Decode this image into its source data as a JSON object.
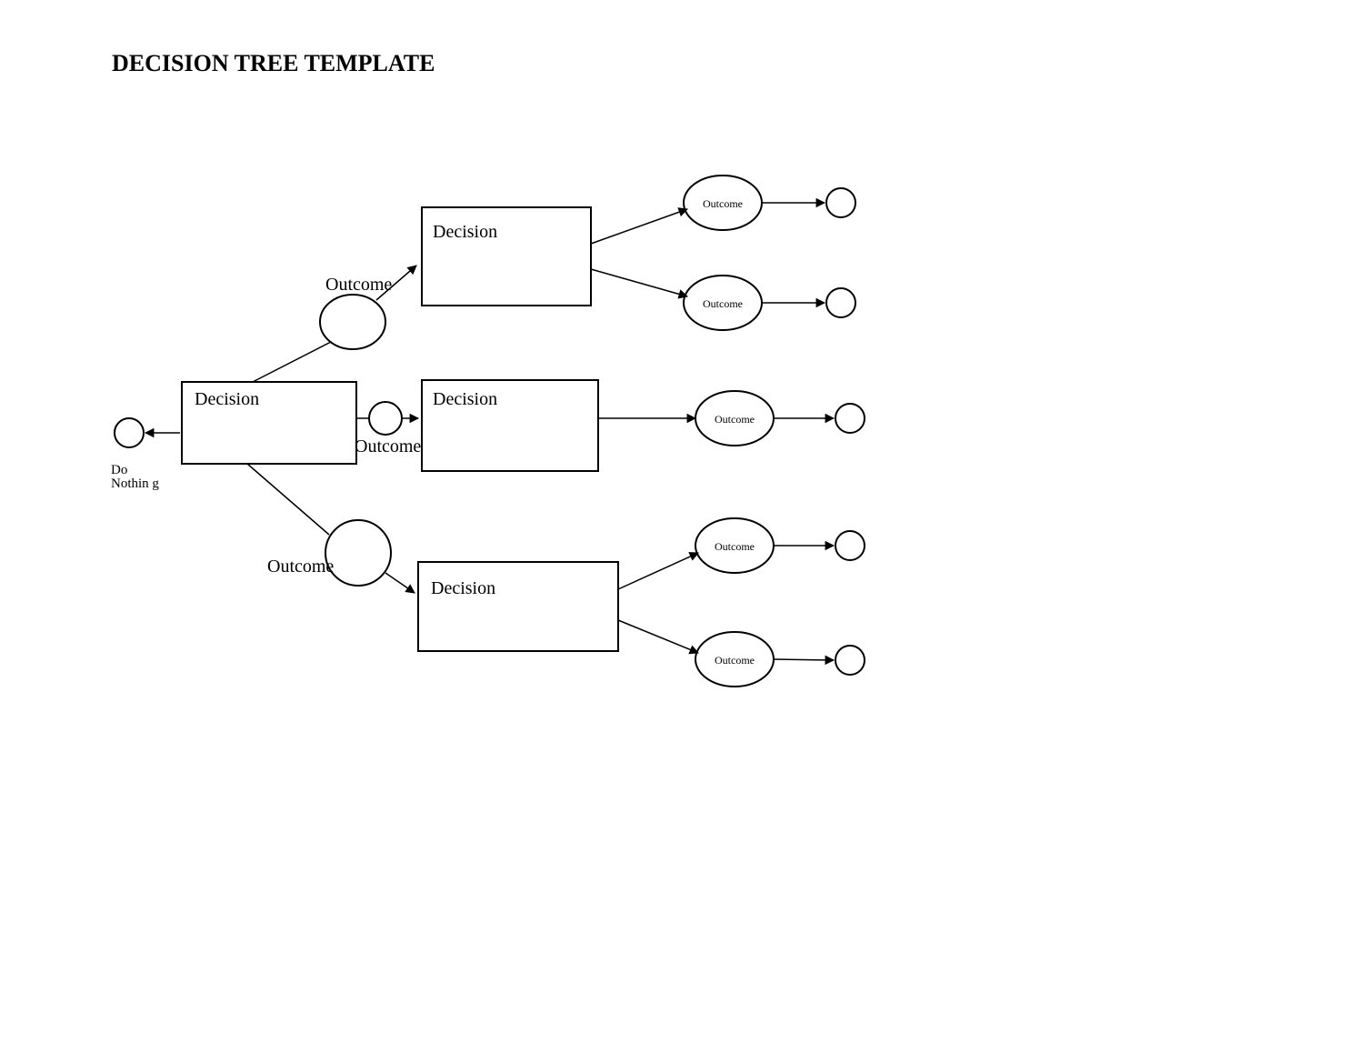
{
  "title": "DECISION TREE TEMPLATE",
  "doNothing1": "Do",
  "doNothing2": "Nothin g",
  "root": {
    "label": "Decision"
  },
  "outcomeTop": {
    "label": "Outcome"
  },
  "outcomeMid": {
    "label": "Outcome"
  },
  "outcomeBottom": {
    "label": "Outcome"
  },
  "decisionTop": {
    "label": "Decision"
  },
  "decisionMid": {
    "label": "Decision"
  },
  "decisionBottom": {
    "label": "Decision"
  },
  "outTopA": {
    "label": "Outcome"
  },
  "outTopB": {
    "label": "Outcome"
  },
  "outMid": {
    "label": "Outcome"
  },
  "outBotA": {
    "label": "Outcome"
  },
  "outBotB": {
    "label": "Outcome"
  }
}
